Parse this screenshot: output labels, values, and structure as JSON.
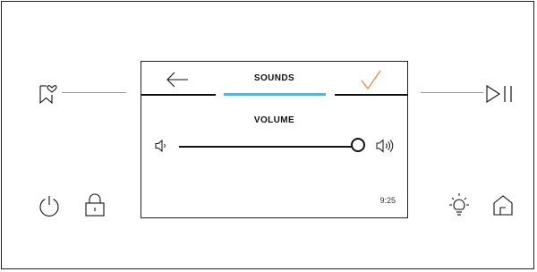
{
  "screen": {
    "title": "SOUNDS",
    "volume_label": "VOLUME",
    "volume_level": 1.0,
    "clock": "9:25",
    "accent_color": "#5ab3dd",
    "confirm_color": "#f08a3c"
  },
  "icons": {
    "favorite": "bookmark-heart-icon",
    "play_pause": "play-pause-icon",
    "power": "power-icon",
    "lock": "lock-icon",
    "light": "lightbulb-icon",
    "home": "home-icon",
    "back": "arrow-left-icon",
    "confirm": "checkmark-icon",
    "volume_low": "speaker-low-icon",
    "volume_high": "speaker-high-icon"
  }
}
